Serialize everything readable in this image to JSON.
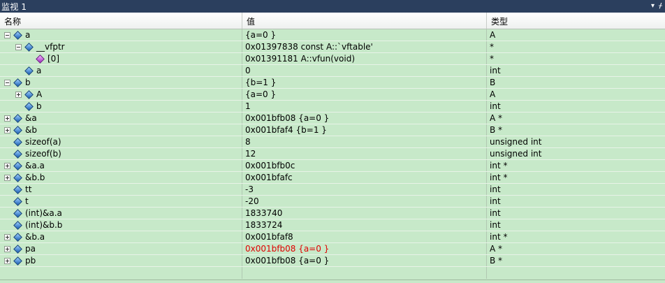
{
  "title": "监视 1",
  "controls": {
    "dropdown": "▾",
    "pin": "ᚋ"
  },
  "columns": {
    "name": "名称",
    "value": "值",
    "type": "类型"
  },
  "rows": [
    {
      "indent": 0,
      "expander": "minus",
      "icon": "variable-icon",
      "name": "a",
      "value": "{a=0 }",
      "type": "A",
      "value_error": false
    },
    {
      "indent": 1,
      "expander": "minus",
      "icon": "variable-icon",
      "name": "__vfptr",
      "value": "0x01397838 const A::`vftable'",
      "type": "*",
      "value_error": false
    },
    {
      "indent": 2,
      "expander": "none",
      "icon": "vtable-entry-icon",
      "name": "[0]",
      "value": "0x01391181 A::vfun(void)",
      "type": "*",
      "value_error": false
    },
    {
      "indent": 1,
      "expander": "none",
      "icon": "variable-icon",
      "name": "a",
      "value": "0",
      "type": "int",
      "value_error": false
    },
    {
      "indent": 0,
      "expander": "minus",
      "icon": "variable-icon",
      "name": "b",
      "value": "{b=1 }",
      "type": "B",
      "value_error": false
    },
    {
      "indent": 1,
      "expander": "plus",
      "icon": "variable-icon",
      "name": "A",
      "value": "{a=0 }",
      "type": "A",
      "value_error": false
    },
    {
      "indent": 1,
      "expander": "none",
      "icon": "variable-icon",
      "name": "b",
      "value": "1",
      "type": "int",
      "value_error": false
    },
    {
      "indent": 0,
      "expander": "plus",
      "icon": "variable-icon",
      "name": "&a",
      "value": "0x001bfb08 {a=0 }",
      "type": "A *",
      "value_error": false
    },
    {
      "indent": 0,
      "expander": "plus",
      "icon": "variable-icon",
      "name": "&b",
      "value": "0x001bfaf4 {b=1 }",
      "type": "B *",
      "value_error": false
    },
    {
      "indent": 0,
      "expander": "none",
      "icon": "variable-icon",
      "name": "sizeof(a)",
      "value": "8",
      "type": "unsigned int",
      "value_error": false
    },
    {
      "indent": 0,
      "expander": "none",
      "icon": "variable-icon",
      "name": "sizeof(b)",
      "value": "12",
      "type": "unsigned int",
      "value_error": false
    },
    {
      "indent": 0,
      "expander": "plus",
      "icon": "variable-icon",
      "name": "&a.a",
      "value": "0x001bfb0c",
      "type": "int *",
      "value_error": false
    },
    {
      "indent": 0,
      "expander": "plus",
      "icon": "variable-icon",
      "name": "&b.b",
      "value": "0x001bfafc",
      "type": "int *",
      "value_error": false
    },
    {
      "indent": 0,
      "expander": "none",
      "icon": "variable-icon",
      "name": "tt",
      "value": "-3",
      "type": "int",
      "value_error": false
    },
    {
      "indent": 0,
      "expander": "none",
      "icon": "variable-icon",
      "name": "t",
      "value": "-20",
      "type": "int",
      "value_error": false
    },
    {
      "indent": 0,
      "expander": "none",
      "icon": "variable-icon",
      "name": "(int)&a.a",
      "value": "1833740",
      "type": "int",
      "value_error": false
    },
    {
      "indent": 0,
      "expander": "none",
      "icon": "variable-icon",
      "name": "(int)&b.b",
      "value": "1833724",
      "type": "int",
      "value_error": false
    },
    {
      "indent": 0,
      "expander": "plus",
      "icon": "variable-icon",
      "name": "&b.a",
      "value": "0x001bfaf8",
      "type": "int *",
      "value_error": false
    },
    {
      "indent": 0,
      "expander": "plus",
      "icon": "variable-icon",
      "name": "pa",
      "value": "0x001bfb08 {a=0 }",
      "type": "A *",
      "value_error": true
    },
    {
      "indent": 0,
      "expander": "plus",
      "icon": "variable-icon",
      "name": "pb",
      "value": "0x001bfb08 {a=0 }",
      "type": "B *",
      "value_error": false
    }
  ],
  "colors": {
    "background": "#c7e9c9",
    "title_bar": "#2b3f5e",
    "changed_value": "#e00000"
  }
}
